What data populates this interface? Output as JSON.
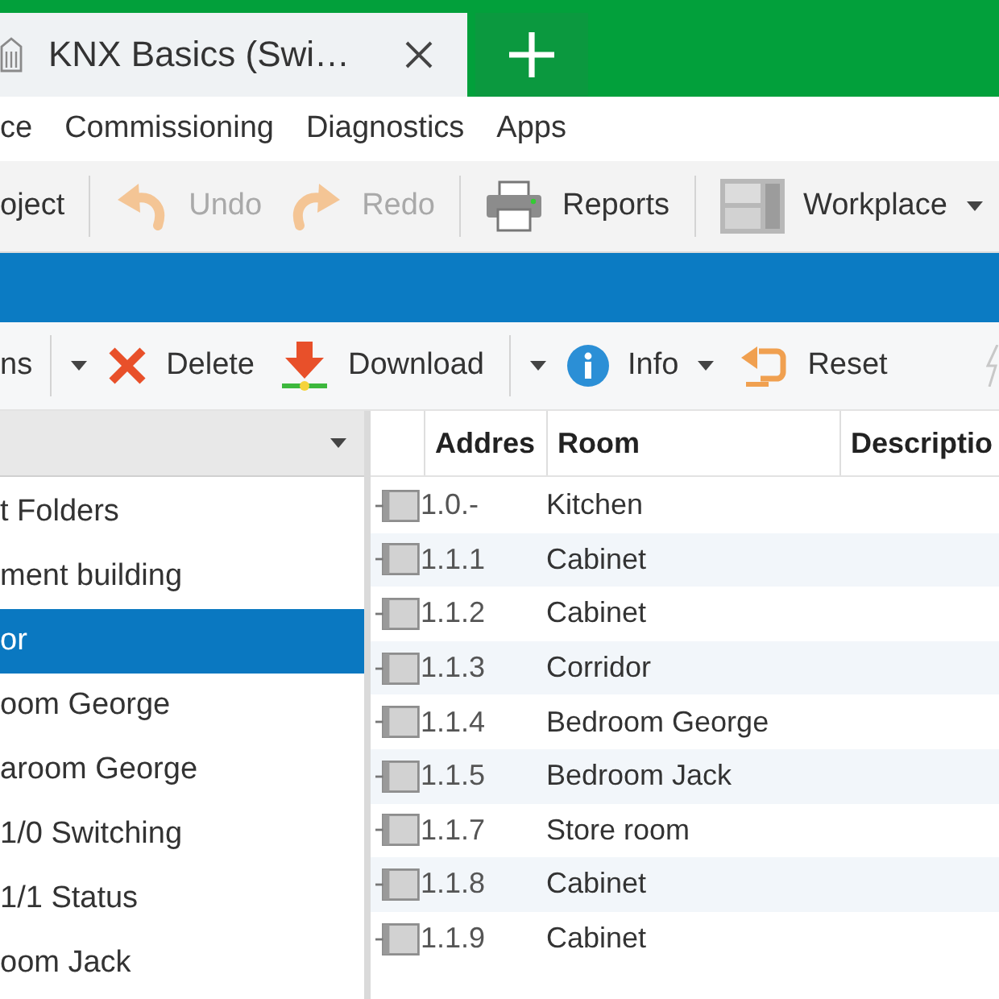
{
  "tab_bar": {
    "tabs": [
      {
        "label": "KNX Basics (Swi…",
        "selected": true
      }
    ]
  },
  "menu_bar": {
    "items": [
      "ce",
      "Commissioning",
      "Diagnostics",
      "Apps"
    ]
  },
  "toolbar": {
    "cut_off_button": {
      "label": "oject",
      "disabled": false
    },
    "undo_button": {
      "label": "Undo",
      "disabled": true
    },
    "redo_button": {
      "label": "Redo",
      "disabled": true
    },
    "reports_button": {
      "label": "Reports",
      "disabled": false
    },
    "workplace_button": {
      "label": "Workplace",
      "disabled": false
    }
  },
  "action_bar": {
    "cut_off_button": {
      "label": "ns"
    },
    "delete_button": {
      "label": "Delete"
    },
    "download_button": {
      "label": "Download"
    },
    "info_button": {
      "label": "Info"
    },
    "reset_button": {
      "label": "Reset"
    }
  },
  "tree": {
    "items": [
      {
        "label": "t Folders",
        "selected": false
      },
      {
        "label": "ment building",
        "selected": false
      },
      {
        "label": "or",
        "selected": true
      },
      {
        "label": "oom George",
        "selected": false
      },
      {
        "label": "aroom George",
        "selected": false
      },
      {
        "label": "1/0 Switching",
        "selected": false
      },
      {
        "label": "1/1 Status",
        "selected": false
      },
      {
        "label": "oom Jack",
        "selected": false
      }
    ]
  },
  "table": {
    "columns": [
      "Addres",
      "Room",
      "Descriptio"
    ],
    "rows": [
      {
        "address": "1.0.-",
        "room": "Kitchen"
      },
      {
        "address": "1.1.1",
        "room": "Cabinet"
      },
      {
        "address": "1.1.2",
        "room": "Cabinet"
      },
      {
        "address": "1.1.3",
        "room": "Corridor"
      },
      {
        "address": "1.1.4",
        "room": "Bedroom George"
      },
      {
        "address": "1.1.5",
        "room": "Bedroom Jack"
      },
      {
        "address": "1.1.7",
        "room": "Store room"
      },
      {
        "address": "1.1.8",
        "room": "Cabinet"
      },
      {
        "address": "1.1.9",
        "room": "Cabinet"
      }
    ]
  }
}
